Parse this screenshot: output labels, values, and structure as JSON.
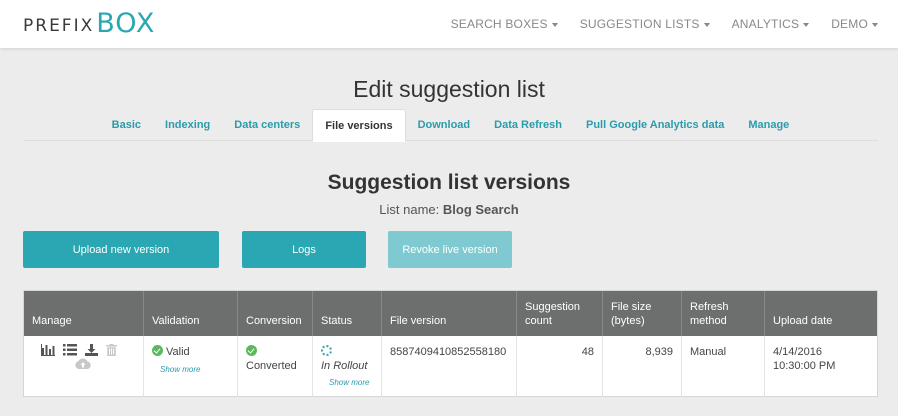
{
  "brand": {
    "prefix": "PREFIX",
    "box": "BOX",
    "color": "#2aa7b3"
  },
  "nav": [
    {
      "label": "SEARCH BOXES"
    },
    {
      "label": "SUGGESTION LISTS"
    },
    {
      "label": "ANALYTICS"
    },
    {
      "label": "DEMO"
    }
  ],
  "page": {
    "title": "Edit suggestion list"
  },
  "tabs": [
    {
      "label": "Basic"
    },
    {
      "label": "Indexing"
    },
    {
      "label": "Data centers"
    },
    {
      "label": "File versions",
      "active": true
    },
    {
      "label": "Download"
    },
    {
      "label": "Data Refresh"
    },
    {
      "label": "Pull Google Analytics data"
    },
    {
      "label": "Manage"
    }
  ],
  "section": {
    "title": "Suggestion list versions",
    "list_name_label": "List name:",
    "list_name_value": "Blog Search"
  },
  "buttons": {
    "upload": "Upload new version",
    "logs": "Logs",
    "revoke": "Revoke live version"
  },
  "table": {
    "headers": {
      "manage": "Manage",
      "validation": "Validation",
      "conversion": "Conversion",
      "status": "Status",
      "file_version": "File version",
      "suggestion_count": "Suggestion count",
      "file_size": "File size (bytes)",
      "refresh_method": "Refresh method",
      "upload_date": "Upload date"
    },
    "rows": [
      {
        "manage_icons": [
          "bar-chart-icon",
          "list-icon",
          "download-icon",
          "trash-icon",
          "cloud-upload-icon"
        ],
        "validation": "Valid",
        "validation_more": "Show more",
        "conversion": "Converted",
        "status": "In Rollout",
        "status_more": "Show more",
        "file_version": "8587409410852558180",
        "suggestion_count": "48",
        "file_size": "8,939",
        "refresh_method": "Manual",
        "upload_date": "4/14/2016",
        "upload_time": "10:30:00 PM"
      }
    ]
  }
}
